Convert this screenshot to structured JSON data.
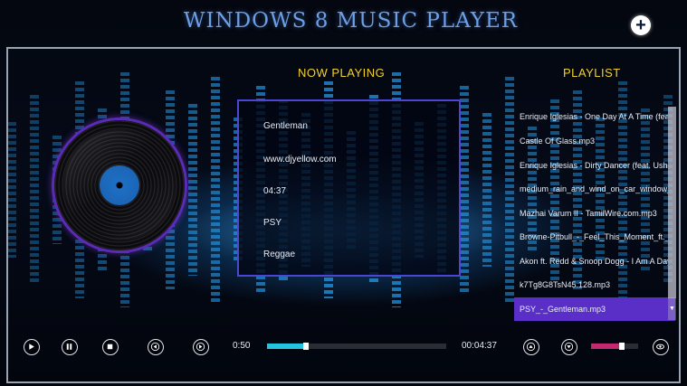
{
  "header": {
    "title": "WINDOWS 8 MUSIC PLAYER",
    "add_icon": "plus-circle-icon"
  },
  "now_playing": {
    "heading": "NOW PLAYING",
    "title": "Gentleman",
    "source": "www.djyellow.com",
    "duration": "04:37",
    "artist": "PSY",
    "genre": "Reggae"
  },
  "playlist": {
    "heading": "PLAYLIST",
    "items": [
      "Enrique Iglesias - One Day At A Time (feat.",
      "Castle Of Glass.mp3",
      "Enrique Iglesias - Dirty Dancer (feat. Usher",
      "medium_rain_and_wind_on_car_window_in",
      "Mazhai Varum II - TamilWire.com.mp3",
      "Browne-Pitbull_-_Feel_This_Moment_ft._C",
      "Akon ft. Redd & Snoop Dogg - I Am A Day",
      "k7Tg8G8TsN45.128.mp3",
      "PSY_-_Gentleman.mp3"
    ],
    "selected_index": 8
  },
  "controls": {
    "elapsed": "0:50",
    "total": "00:04:37",
    "progress_fraction": 0.2,
    "volume_fraction": 0.6,
    "icons": [
      "play-icon",
      "pause-icon",
      "stop-icon",
      "previous-icon",
      "next-icon",
      "move-up-icon",
      "move-down-icon",
      "eye-icon"
    ]
  },
  "colors": {
    "title": "#6d9ee6",
    "heading": "#f2d12c",
    "accent_purple": "#5a2fc8",
    "progress": "#23c4e0",
    "volume": "#c4286e"
  }
}
